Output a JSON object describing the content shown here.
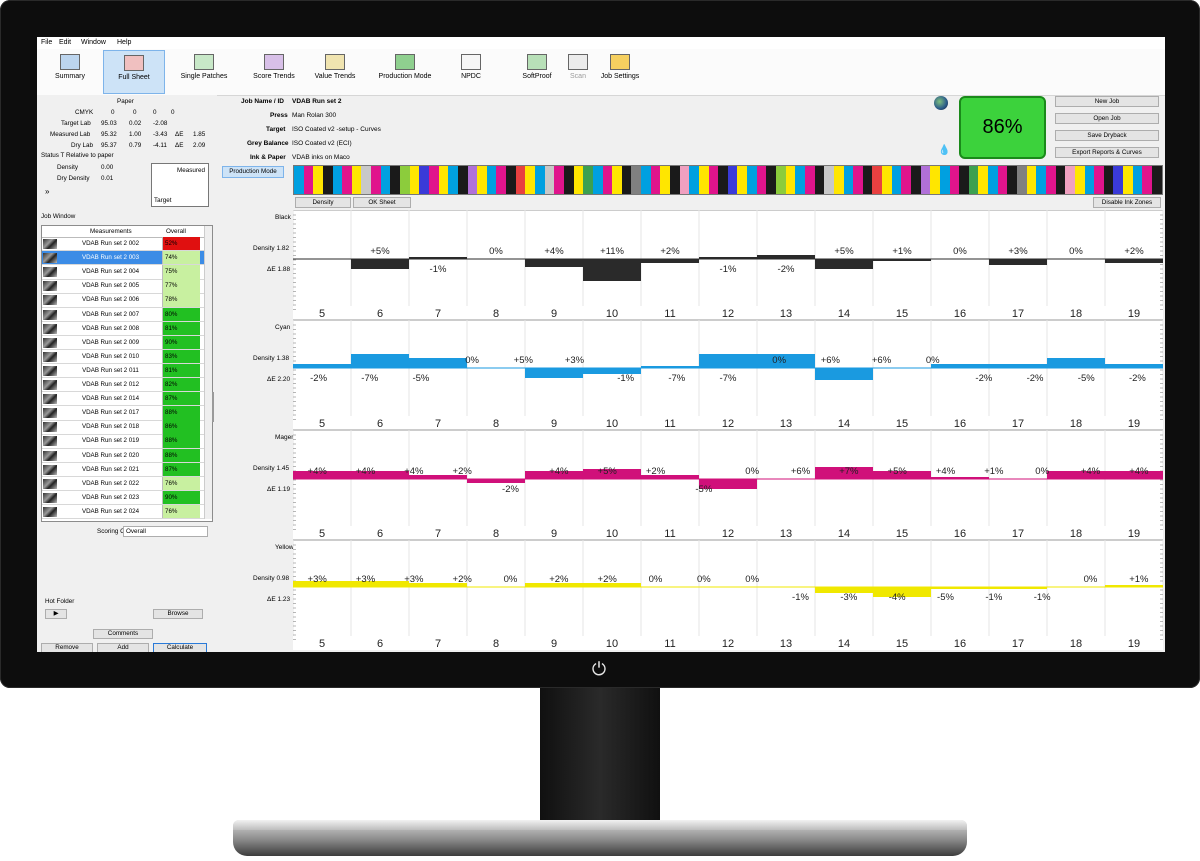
{
  "menu": [
    "File",
    "Edit",
    "Window",
    "Help"
  ],
  "toolbar": [
    {
      "label": "Summary",
      "icon": "summary-icon",
      "active": false,
      "disabled": false,
      "color": "#bcd5ee"
    },
    {
      "label": "Full Sheet",
      "icon": "full-sheet-icon",
      "active": true,
      "disabled": false,
      "color": "#f0c0c0"
    },
    {
      "label": "Single Patches",
      "icon": "single-patches-icon",
      "active": false,
      "disabled": false,
      "color": "#c8e8c8"
    },
    {
      "label": "Score Trends",
      "icon": "score-trends-icon",
      "active": false,
      "disabled": false,
      "color": "#d8c0e8"
    },
    {
      "label": "Value Trends",
      "icon": "value-trends-icon",
      "active": false,
      "disabled": false,
      "color": "#f0e4b0"
    },
    {
      "label": "Production Mode",
      "icon": "production-mode-icon",
      "active": false,
      "disabled": false,
      "color": "#8fd08f"
    },
    {
      "label": "NPDC",
      "icon": "npdc-icon",
      "active": false,
      "disabled": false,
      "color": "#f6f6f6"
    },
    {
      "label": "SoftProof",
      "icon": "softproof-icon",
      "active": false,
      "disabled": false,
      "color": "#b8e0b8"
    },
    {
      "label": "Scan",
      "icon": "scan-icon",
      "active": false,
      "disabled": true,
      "color": "#ececec"
    },
    {
      "label": "Job Settings",
      "icon": "job-settings-icon",
      "active": false,
      "disabled": false,
      "color": "#f6d060"
    }
  ],
  "paper": {
    "heading": "Paper",
    "cmyk_label": "CMYK",
    "cmyk": [
      "0",
      "0",
      "0",
      "0"
    ],
    "target_lab_label": "Target Lab",
    "target_lab": [
      "95.03",
      "0.02",
      "-2.08"
    ],
    "measured_lab_label": "Measured Lab",
    "measured_lab": [
      "95.32",
      "1.00",
      "-3.43"
    ],
    "measured_de_label": "ΔE",
    "measured_de": "1.85",
    "dry_lab_label": "Dry Lab",
    "dry_lab": [
      "95.37",
      "0.79",
      "-4.11"
    ],
    "dry_de_label": "ΔE",
    "dry_de": "2.09",
    "status_label": "Status T Relative to paper",
    "density_label": "Density",
    "density": "0.00",
    "dry_density_label": "Dry Density",
    "dry_density": "0.01",
    "swatch_measured": "Measured",
    "swatch_target": "Target",
    "expand": "»"
  },
  "job_window": {
    "title": "Job Window",
    "col_measurements": "Measurements",
    "col_overall": "Overall",
    "rows": [
      {
        "name": "VDAB Run set 2 002",
        "score": "52%",
        "color": "#e01010",
        "selected": false
      },
      {
        "name": "VDAB Run set 2 003",
        "score": "74%",
        "color": "#c8f0a0",
        "selected": true
      },
      {
        "name": "VDAB Run set 2 004",
        "score": "75%",
        "color": "#c8f0a0",
        "selected": false
      },
      {
        "name": "VDAB Run set 2 005",
        "score": "77%",
        "color": "#c8f0a0",
        "selected": false
      },
      {
        "name": "VDAB Run set 2 006",
        "score": "78%",
        "color": "#c8f0a0",
        "selected": false
      },
      {
        "name": "VDAB Run set 2 007",
        "score": "80%",
        "color": "#22c022",
        "selected": false
      },
      {
        "name": "VDAB Run set 2 008",
        "score": "81%",
        "color": "#22c022",
        "selected": false
      },
      {
        "name": "VDAB Run set 2 009",
        "score": "90%",
        "color": "#22c022",
        "selected": false
      },
      {
        "name": "VDAB Run set 2 010",
        "score": "83%",
        "color": "#22c022",
        "selected": false
      },
      {
        "name": "VDAB Run set 2 011",
        "score": "81%",
        "color": "#22c022",
        "selected": false
      },
      {
        "name": "VDAB Run set 2 012",
        "score": "82%",
        "color": "#22c022",
        "selected": false
      },
      {
        "name": "VDAB Run set 2 014",
        "score": "87%",
        "color": "#22c022",
        "selected": false
      },
      {
        "name": "VDAB Run set 2 017",
        "score": "88%",
        "color": "#22c022",
        "selected": false
      },
      {
        "name": "VDAB Run set 2 018",
        "score": "86%",
        "color": "#22c022",
        "selected": false
      },
      {
        "name": "VDAB Run set 2 019",
        "score": "88%",
        "color": "#22c022",
        "selected": false
      },
      {
        "name": "VDAB Run set 2 020",
        "score": "88%",
        "color": "#22c022",
        "selected": false
      },
      {
        "name": "VDAB Run set 2 021",
        "score": "87%",
        "color": "#22c022",
        "selected": false
      },
      {
        "name": "VDAB Run set 2 022",
        "score": "76%",
        "color": "#c8f0a0",
        "selected": false
      },
      {
        "name": "VDAB Run set 2 023",
        "score": "90%",
        "color": "#22c022",
        "selected": false
      },
      {
        "name": "VDAB Run set 2 024",
        "score": "76%",
        "color": "#c8f0a0",
        "selected": false
      }
    ],
    "scoring_label": "Scoring Column",
    "scoring_value": "Overall"
  },
  "hot_folder": {
    "title": "Hot Folder",
    "play": "▶",
    "browse": "Browse"
  },
  "bottom_buttons": {
    "comments": "Comments",
    "remove": "Remove",
    "add": "Add",
    "calculate": "Calculate"
  },
  "job_info": {
    "job_label": "Job Name / ID",
    "job": "VDAB Run set 2",
    "press_label": "Press",
    "press": "Man Rolan 300",
    "target_label": "Target",
    "target": "ISO Coated v2 -setup - Curves",
    "grey_label": "Grey Balance",
    "grey": "ISO Coated v2 (ECI)",
    "ink_label": "Ink & Paper",
    "ink": "VDAB inks on Maco"
  },
  "production_mode_btn": "Production Mode",
  "score": "86%",
  "right_buttons": [
    "New Job",
    "Open Job",
    "Save Dryback",
    "Export Reports & Curves"
  ],
  "tab_buttons": {
    "density": "Density",
    "ok_sheet": "OK Sheet",
    "disable": "Disable Ink Zones"
  },
  "colorbar": [
    "#00a0e0",
    "#e0148c",
    "#ffe600",
    "#1a1a1a",
    "#00a0e0",
    "#e0148c",
    "#ffe600",
    "#c8c8c8",
    "#e0148c",
    "#00a0e0",
    "#1a1a1a",
    "#8ccc3c",
    "#ffe600",
    "#3a3ad8",
    "#e0148c",
    "#ffe600",
    "#00a0e0",
    "#1a1a1a",
    "#b070d8",
    "#ffe600",
    "#00a0e0",
    "#e0148c",
    "#1a1a1a",
    "#e84040",
    "#ffe600",
    "#00a0e0",
    "#c8c8c8",
    "#e0148c",
    "#1a1a1a",
    "#ffe600",
    "#3ca050",
    "#00a0e0",
    "#e0148c",
    "#ffe600",
    "#1a1a1a",
    "#808080",
    "#00a0e0",
    "#e0148c",
    "#ffe600",
    "#1a1a1a",
    "#f0a0c0",
    "#00a0e0",
    "#ffe600",
    "#e0148c",
    "#1a1a1a",
    "#3a3ad8",
    "#ffe600",
    "#00a0e0",
    "#e0148c",
    "#1a1a1a",
    "#8ccc3c",
    "#ffe600",
    "#00a0e0",
    "#e0148c",
    "#1a1a1a",
    "#c8c8c8",
    "#ffe600",
    "#00a0e0",
    "#e0148c",
    "#1a1a1a",
    "#e84040",
    "#ffe600",
    "#00a0e0",
    "#e0148c",
    "#1a1a1a",
    "#b070d8",
    "#ffe600",
    "#00a0e0",
    "#e0148c",
    "#1a1a1a",
    "#3ca050",
    "#ffe600",
    "#00a0e0",
    "#e0148c",
    "#1a1a1a",
    "#808080",
    "#ffe600",
    "#00a0e0",
    "#e0148c",
    "#1a1a1a",
    "#f0a0c0",
    "#ffe600",
    "#00a0e0",
    "#e0148c",
    "#1a1a1a",
    "#3a3ad8",
    "#ffe600",
    "#00a0e0",
    "#e0148c",
    "#1a1a1a"
  ],
  "chart_data": {
    "type": "bar",
    "categories": [
      "5",
      "6",
      "7",
      "8",
      "9",
      "10",
      "11",
      "12",
      "13",
      "14",
      "15",
      "16",
      "17",
      "18",
      "19"
    ],
    "series": [
      {
        "name": "Black",
        "color": "#2a2a2a",
        "density": "1.82",
        "de": "1.88",
        "labels": [
          "",
          "+5%",
          "-1%",
          "0%",
          "+4%",
          "+11%",
          "+2%",
          "-1%",
          "-2%",
          "+5%",
          "+1%",
          "0%",
          "+3%",
          "0%",
          "+2%"
        ],
        "values": [
          0,
          -5,
          1,
          0,
          -4,
          -11,
          -2,
          1,
          2,
          -5,
          -1,
          0,
          -3,
          0,
          -2
        ]
      },
      {
        "name": "Cyan",
        "color": "#1a9ae0",
        "density": "1.38",
        "de": "2.20",
        "labels": [
          "-2%",
          "-7%",
          "-5%",
          "0%",
          "+5%",
          "+3%",
          "-1%",
          "-7%",
          "-7%",
          "0%",
          "+6%",
          "+6%",
          "0%",
          "-2%",
          "-2%",
          "-5%",
          "-2%"
        ],
        "values": [
          2,
          7,
          5,
          0,
          -5,
          -3,
          1,
          7,
          7,
          -6,
          0,
          2,
          2,
          5,
          2
        ]
      },
      {
        "name": "Magenta",
        "color": "#d0107a",
        "density": "1.45",
        "de": "1.19",
        "labels": [
          "+4%",
          "+4%",
          "+4%",
          "+2%",
          "-2%",
          "+4%",
          "+5%",
          "+2%",
          "-5%",
          "0%",
          "+6%",
          "+7%",
          "+5%",
          "+4%",
          "+1%",
          "0%",
          "+4%",
          "+4%"
        ],
        "values": [
          4,
          4,
          2,
          -2,
          4,
          5,
          2,
          -5,
          0,
          6,
          4,
          1,
          0,
          4,
          4
        ]
      },
      {
        "name": "Yellow",
        "color": "#f0e800",
        "density": "0.98",
        "de": "1.23",
        "labels": [
          "+3%",
          "+3%",
          "+3%",
          "+2%",
          "0%",
          "+2%",
          "+2%",
          "0%",
          "0%",
          "0%",
          "-1%",
          "-3%",
          "-4%",
          "-5%",
          "-1%",
          "-1%",
          "0%",
          "+1%"
        ],
        "values": [
          3,
          3,
          2,
          0,
          2,
          2,
          0,
          0,
          0,
          -3,
          -5,
          -1,
          -1,
          0,
          1
        ]
      }
    ]
  }
}
